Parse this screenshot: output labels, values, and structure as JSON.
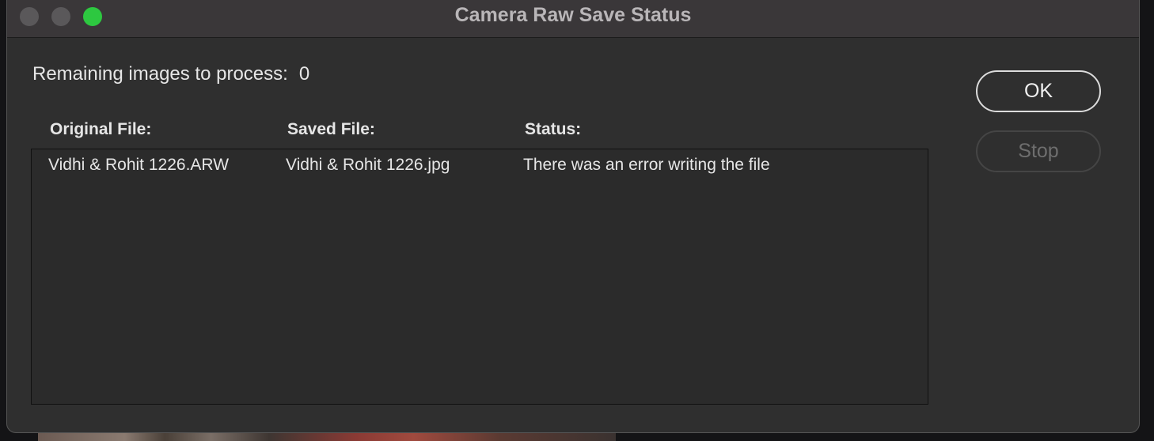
{
  "window": {
    "title": "Camera Raw Save Status"
  },
  "remaining": {
    "label": "Remaining images to process:",
    "count": "0"
  },
  "table": {
    "headers": [
      "Original File:",
      "Saved File:",
      "Status:"
    ],
    "rows": [
      {
        "original": "Vidhi & Rohit 1226.ARW",
        "saved": "Vidhi & Rohit 1226.jpg",
        "status": "There was an error writing the file"
      }
    ]
  },
  "buttons": {
    "ok_label": "OK",
    "stop_label": "Stop",
    "stop_enabled": false
  },
  "colors": {
    "zoom_button": "#2dc840",
    "window_bg": "#2f2f2f",
    "titlebar_bg": "#3a3739"
  }
}
